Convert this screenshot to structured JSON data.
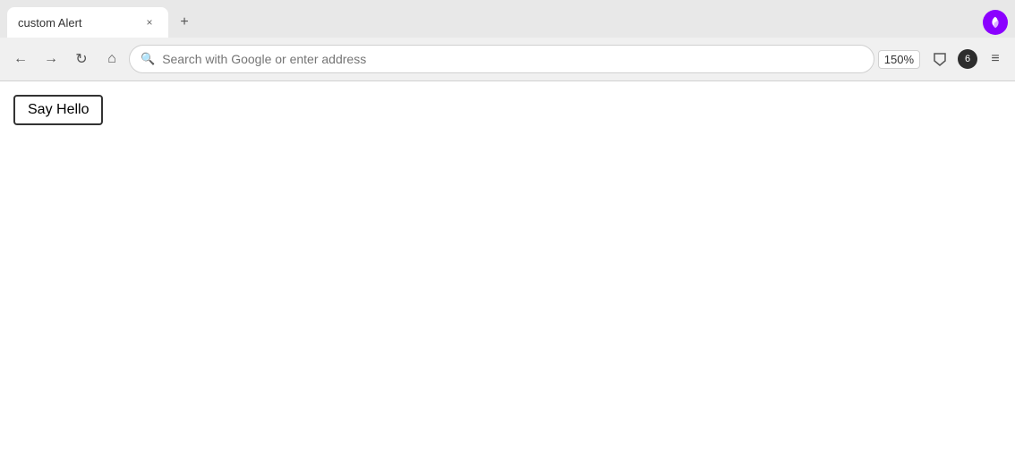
{
  "browser": {
    "tab": {
      "title": "custom Alert",
      "close_label": "×"
    },
    "new_tab_label": "+",
    "logo_label": "Firefox browser logo",
    "nav": {
      "back_label": "←",
      "forward_label": "→",
      "refresh_label": "↻",
      "home_label": "⌂",
      "address_placeholder": "Search with Google or enter address",
      "address_value": "Search with Google or enter address",
      "zoom": "150%"
    },
    "toolbar": {
      "pocket_label": "pocket-icon",
      "notifications_count": "6",
      "menu_label": "≡"
    }
  },
  "page": {
    "button_label": "Say Hello"
  }
}
